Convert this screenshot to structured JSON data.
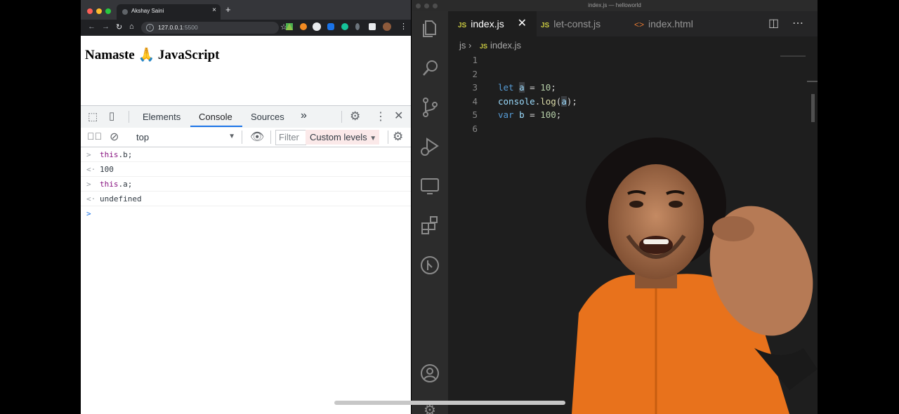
{
  "browser": {
    "tab_title": "Akshay Saini",
    "tab_close": "×",
    "new_tab": "+",
    "nav": {
      "back": "←",
      "forward": "→",
      "reload": "↻",
      "home": "⌂"
    },
    "url_host": "127.0.0.1",
    "url_port": ":5500",
    "page_heading": "Namaste 🙏 JavaScript"
  },
  "devtools": {
    "tabs": [
      "Elements",
      "Console",
      "Sources"
    ],
    "more_tabs": "»",
    "context": "top",
    "filter_placeholder": "Filter",
    "levels": "Custom levels",
    "console": [
      {
        "prefix": ">",
        "kw": "this",
        "rest": ".b;"
      },
      {
        "prefix": "<·",
        "value": "100"
      },
      {
        "prefix": ">",
        "kw": "this",
        "rest": ".a;"
      },
      {
        "prefix": "<·",
        "value": "undefined"
      },
      {
        "prefix": ">",
        "value": ""
      }
    ]
  },
  "vscode": {
    "window_title": "index.js — helloworld",
    "tabs": [
      {
        "badge": "JS",
        "label": "index.js",
        "active": true
      },
      {
        "badge": "JS",
        "label": "let-const.js",
        "active": false
      },
      {
        "badge": "<>",
        "label": "index.html",
        "active": false
      }
    ],
    "breadcrumb": {
      "folder": "js",
      "file_badge": "JS",
      "file": "index.js"
    },
    "code": [
      {
        "n": "1"
      },
      {
        "n": "2"
      },
      {
        "n": "3",
        "k": "let",
        "v": "a",
        "op": " = ",
        "num": "10",
        "end": ";"
      },
      {
        "n": "4",
        "obj": "console",
        "dot": ".",
        "fn": "log",
        "open": "(",
        "v": "a",
        "close": ");"
      },
      {
        "n": "5",
        "k": "var",
        "v": "b",
        "op": " = ",
        "num": "100",
        "end": ";"
      },
      {
        "n": "6"
      }
    ]
  },
  "colors": {
    "accent": "#1a73e8",
    "keyword": "#569cd6",
    "variable": "#9cdcfe",
    "number": "#b5cea8",
    "shirt": "#e8721c"
  }
}
